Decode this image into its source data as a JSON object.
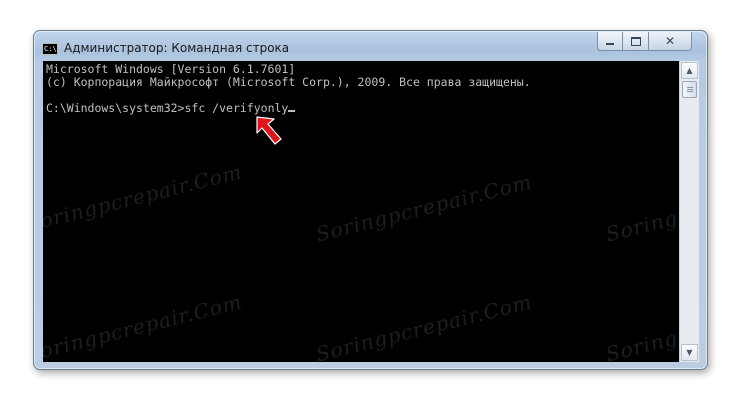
{
  "window": {
    "title": "Администратор: Командная строка",
    "icon": "cmd-icon",
    "icon_text": "C:\\",
    "controls": {
      "minimize": "minimize-icon",
      "maximize": "maximize-icon",
      "close_symbol": "✕"
    }
  },
  "console": {
    "line1": "Microsoft Windows [Version 6.1.7601]",
    "line2": "(c) Корпорация Майкрософт (Microsoft Corp.), 2009. Все права защищены.",
    "prompt": "C:\\Windows\\system32>",
    "command": "sfc /verifyonly"
  },
  "watermark": {
    "text": "Soringpcrepair.Com"
  },
  "colors": {
    "console_bg": "#000000",
    "console_text": "#c0c0c0",
    "arrow": "#e0141b"
  },
  "scrollbar": {
    "up_symbol": "▲",
    "down_symbol": "▼"
  }
}
